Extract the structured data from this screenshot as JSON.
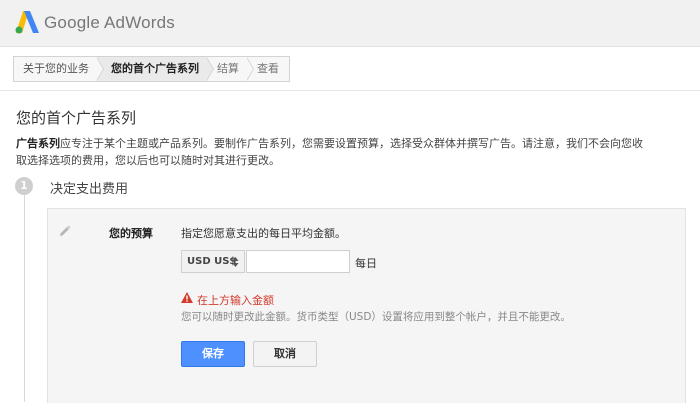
{
  "header": {
    "brand": "Google AdWords",
    "logo_colors": [
      "#4285f4",
      "#34a853",
      "#fbbc05"
    ]
  },
  "breadcrumb": {
    "steps": [
      {
        "label": "关于您的业务",
        "state": "done"
      },
      {
        "label": "您的首个广告系列",
        "state": "active"
      },
      {
        "label": "结算",
        "state": "upcoming"
      },
      {
        "label": "查看",
        "state": "upcoming"
      }
    ]
  },
  "main": {
    "title": "您的首个广告系列",
    "description_term": "广告系列",
    "description_line1": "应专注于某个主题或产品系列。要制作广告系列，您需要设置预算，选择受众群体并撰写广告。请注意，我们不会向您收",
    "description_line2": "取选择选项的费用，您以后也可以随时对其进行更改。"
  },
  "step": {
    "number": "1",
    "title": "决定支出费用"
  },
  "budget": {
    "label": "您的预算",
    "hint": "指定您愿意支出的每日平均金额。",
    "currency": "USD US$",
    "amount_value": "",
    "amount_placeholder": "",
    "per_day": "每日",
    "error": "在上方输入金额",
    "note": "您可以随时更改此金额。货币类型（USD）设置将应用到整个帐户，并且不能更改。",
    "save_label": "保存",
    "cancel_label": "取消"
  },
  "colors": {
    "primary_button": "#4d90fe",
    "error": "#d23a2b"
  }
}
